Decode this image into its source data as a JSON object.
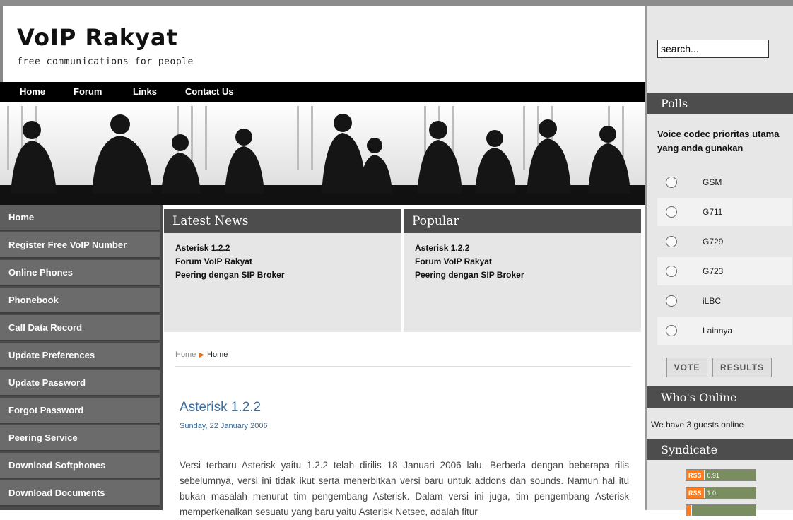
{
  "header": {
    "title": "VoIP Rakyat",
    "tagline": "free communications for people"
  },
  "topnav": [
    "Home",
    "Forum",
    "Links",
    "Contact Us"
  ],
  "leftnav": [
    "Home",
    "Register Free VoIP Number",
    "Online Phones",
    "Phonebook",
    "Call Data Record",
    "Update Preferences",
    "Update Password",
    "Forgot Password",
    "Peering Service",
    "Download Softphones",
    "Download Documents"
  ],
  "latest_news": {
    "heading": "Latest News",
    "items": [
      "Asterisk 1.2.2",
      "Forum VoIP Rakyat",
      "Peering dengan SIP Broker"
    ]
  },
  "popular": {
    "heading": "Popular",
    "items": [
      "Asterisk 1.2.2",
      "Forum VoIP Rakyat",
      "Peering dengan SIP Broker"
    ]
  },
  "breadcrumb": {
    "root": "Home",
    "current": "Home"
  },
  "article": {
    "title": "Asterisk 1.2.2",
    "date": "Sunday, 22 January 2006",
    "body": "Versi terbaru Asterisk yaitu 1.2.2 telah dirilis 18 Januari 2006 lalu. Berbeda dengan beberapa rilis sebelumnya, versi ini tidak ikut serta menerbitkan versi baru untuk addons dan sounds. Namun hal itu bukan masalah menurut tim pengembang Asterisk. Dalam versi ini juga, tim pengembang Asterisk memperkenalkan sesuatu yang baru yaitu Asterisk Netsec, adalah fitur"
  },
  "search": {
    "value": "search..."
  },
  "polls": {
    "heading": "Polls",
    "question": "Voice codec prioritas utama yang anda gunakan",
    "options": [
      "GSM",
      "G711",
      "G729",
      "G723",
      "iLBC",
      "Lainnya"
    ],
    "vote_label": "VOTE",
    "results_label": "RESULTS"
  },
  "whos_online": {
    "heading": "Who's Online",
    "text": "We have 3 guests online"
  },
  "syndicate": {
    "heading": "Syndicate",
    "feeds": [
      {
        "tag": "RSS",
        "version": "0.91"
      },
      {
        "tag": "RSS",
        "version": "1.0"
      }
    ]
  },
  "colors": {
    "nav_bg": "#000000",
    "sidebar_item": "#6b6b6b",
    "box_head": "#4d4d4d",
    "article_title": "#3b6e9e",
    "rss_orange": "#ff7b1c"
  }
}
